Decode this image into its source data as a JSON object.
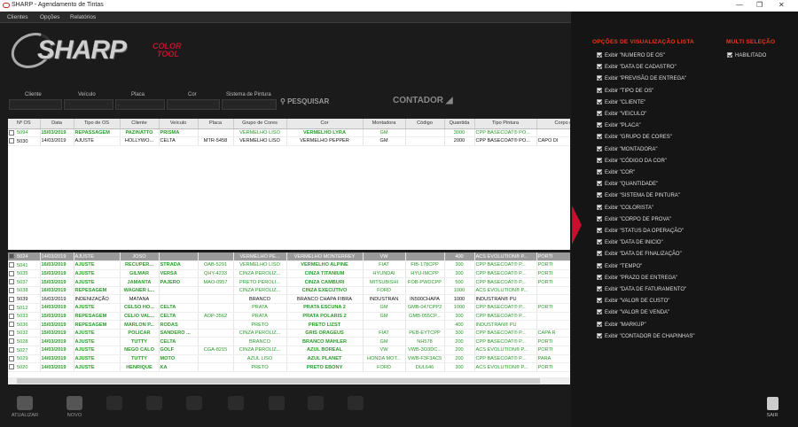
{
  "window": {
    "title": "SHARP - Agendamento de Tintas"
  },
  "menu": [
    "Clientes",
    "Opções",
    "Relatórios"
  ],
  "filters": {
    "labels": [
      "Cliente",
      "Veículo",
      "Placa",
      "Cor",
      "Sistema de Pintura"
    ]
  },
  "search_label": "PESQUISAR",
  "counter_label": "CONTADOR",
  "grid1": {
    "headers": [
      "Nº OS",
      "Data",
      "Tipo de OS",
      "Cliente",
      "Veículo",
      "Placa",
      "Grupo de Cores",
      "Cor",
      "Montadora",
      "Código",
      "Quantida",
      "Tipo Pintura",
      "Corpo de"
    ],
    "rows": [
      {
        "style": "green",
        "cells": [
          "5094",
          "15/03/2019",
          "REPASSAGEM",
          "PAZINATTO",
          "PRISMA",
          "",
          "VERMELHO LISO",
          "VERMELHO LYRA",
          "GM",
          "",
          "3000",
          "CPP BASECOAT® PO...",
          ""
        ]
      },
      {
        "style": "black",
        "cells": [
          "5030",
          "14/03/2019",
          "AJUSTE",
          "HOLLYWO...",
          "CELTA",
          "MTR-5458",
          "VERMELHO LISO",
          "VERMELHO PEPPER",
          "GM",
          "",
          "2000",
          "CPP BASECOAT® PO...",
          "CAPO DI"
        ]
      }
    ]
  },
  "grid2": {
    "rows": [
      {
        "style": "sel",
        "checked": true,
        "cells": [
          "5024",
          "14/03/2019",
          "AJUSTE",
          "JOSO",
          "",
          "",
          "VERMELHO PE...",
          "VERMELHO MONTERREY",
          "VW",
          "",
          "400",
          "ACS EVOLUTION® P...",
          "PORTI"
        ]
      },
      {
        "style": "green",
        "cells": [
          "5041",
          "16/03/2019",
          "AJUSTE",
          "RECUPER...",
          "STRADA",
          "OAB-5291",
          "VERMELHO LISO",
          "VERMELHO ALPINE",
          "FIAT",
          "FIB-178CPP",
          "300",
          "CPP BASECOAT® P...",
          "PORTI"
        ]
      },
      {
        "style": "green",
        "cells": [
          "5035",
          "15/03/2019",
          "AJUSTE",
          "GILMAR",
          "VERSA",
          "QHY-4233",
          "CINZA PEROLIZ...",
          "CINZA TITANIUM",
          "HYUNDAI",
          "HYU-IMCPP",
          "300",
          "CPP BASECOAT® P...",
          "PORTI"
        ]
      },
      {
        "style": "green",
        "cells": [
          "5037",
          "15/03/2019",
          "AJUSTE",
          "JAMANTA",
          "PAJERO",
          "MAO-0957",
          "PRETO PEROLI...",
          "CINZA CAMBURI",
          "MITSUBISHI",
          "FOB-PWDCPP",
          "500",
          "CPP BASECOAT® P...",
          "PORTI"
        ]
      },
      {
        "style": "green",
        "cells": [
          "5038",
          "16/03/2019",
          "REPESAGEM",
          "WAGNER L...",
          "",
          "",
          "CINZA PEROLIZ...",
          "CINZA EXECUTIVO",
          "FORD",
          "",
          "1000",
          "ACS EVOLUTION® P...",
          ""
        ]
      },
      {
        "style": "black",
        "cells": [
          "5039",
          "16/03/2019",
          "INDENIZAÇÃO",
          "MATANA",
          "",
          "",
          "BRANCO",
          "BRANCO CHAPA FIBRA",
          "INDUSTRAN",
          "IN500CHAPA",
          "1000",
          "INDUSTRAN® PU",
          ""
        ]
      },
      {
        "style": "green",
        "cells": [
          "5012",
          "14/03/2019",
          "AJUSTE",
          "CELSO HO...",
          "CELTA",
          "",
          "PRATA",
          "PRATA ESCUNA 2",
          "GM",
          "GMB-047CPP2",
          "1000",
          "CPP BASECOAT® P...",
          "PORTI"
        ]
      },
      {
        "style": "green",
        "cells": [
          "5033",
          "15/03/2019",
          "REPESAGEM",
          "CELIO VAL...",
          "CELTA",
          "AOP-3562",
          "PRATA",
          "PRATA POLARIS 2",
          "GM",
          "GMB-055CP...",
          "300",
          "CPP BASECOAT® P...",
          ""
        ]
      },
      {
        "style": "green",
        "cells": [
          "5036",
          "15/03/2019",
          "REPESAGEM",
          "MARLON P...",
          "RODAS",
          "",
          "PRETO",
          "PRETO LIZST",
          "",
          "",
          "400",
          "INDUSTRAN® PU",
          ""
        ]
      },
      {
        "style": "green",
        "cells": [
          "5032",
          "15/03/2019",
          "AJUSTE",
          "POLICAR",
          "SANDERO ...",
          "",
          "CINZA PEROLIZ...",
          "GRIS ORAGEUS",
          "FIAT",
          "PEB-EYTCPP",
          "300",
          "CPP BASECOAT® P...",
          "CAPA R"
        ]
      },
      {
        "style": "green",
        "cells": [
          "5028",
          "14/03/2019",
          "AJUSTE",
          "TUTTY",
          "CELTA",
          "",
          "BRANCO",
          "BRANCO MAHLER",
          "GM",
          "NH578",
          "200",
          "CPP BASECOAT® P...",
          "PORTI"
        ]
      },
      {
        "style": "green",
        "cells": [
          "5027",
          "14/03/2019",
          "AJUSTE",
          "NEGO CALO",
          "GOLF",
          "CGA-8215",
          "CINZA PEROLIZ...",
          "AZUL BOREAL",
          "VW",
          "VWB-3O3DC...",
          "200",
          "ACS EVOLUTION® P...",
          "PORTI"
        ]
      },
      {
        "style": "green",
        "cells": [
          "5029",
          "14/03/2019",
          "AJUSTE",
          "TUTTY",
          "MOTO",
          "",
          "AZUL LISO",
          "AZUL PLANET",
          "HONDA MOT...",
          "VWB-F3F3AC5",
          "200",
          "CPP BASECOAT® P...",
          "PARA"
        ]
      },
      {
        "style": "green",
        "cells": [
          "5020",
          "14/03/2019",
          "AJUSTE",
          "HENRIQUE",
          "KA",
          "",
          "PRETO",
          "PRETO EBONY",
          "FORD",
          "DUL646",
          "300",
          "ACS EVOLUTION® P...",
          "PORTI"
        ]
      }
    ]
  },
  "toolbar": {
    "atualizar": "ATUALIZAR",
    "novo": "NOVO",
    "sair": "SAIR"
  },
  "side": {
    "title": "OPÇÕES DE VISUALIZAÇÃO LISTA",
    "multi_title": "MULTI SELEÇÃO",
    "multi_opt": "HABILITADO",
    "options": [
      "Exibir \"NUMERO DE OS\"",
      "Exibir \"DATA DE CADASTRO\"",
      "Exibir \"PREVISÃO DE ENTREGA\"",
      "Exibir \"TIPO DE OS\"",
      "Exibir \"CLIENTE\"",
      "Exibir \"VEICULO\"",
      "Exibir \"PLACA\"",
      "Exibir \"GRUPO DE CORES\"",
      "Exibir \"MONTADORA\"",
      "Exibir \"CÓDIGO DA COR\"",
      "Exibir \"COR\"",
      "Exibir \"QUANTIDADE\"",
      "Exibir \"SISTEMA DE PINTURA\"",
      "Exibir \"COLORISTA\"",
      "Exibir \"CORPO DE PROVA\"",
      "Exibir \"STATUS DA OPERAÇÃO\"",
      "Exibir \"DATA DE INICIO\"",
      "Exibir \"DATA DE FINALIZAÇÃO\"",
      "Exibir \"TEMPO\"",
      "Exibir \"PRAZO DE ENTREGA\"",
      "Exibir \"DATA DE FATURAMENTO\"",
      "Exibir \"VALOR DE CUSTO\"",
      "Exibir \"VALOR DE VENDA\"",
      "Exibir \"MARKUP\"",
      "Exibir \"CONTADOR DE CHAPINHAS\""
    ]
  },
  "colors": {
    "accent": "#c8102e",
    "green": "#2a9a2a",
    "bg": "#1b1b1b"
  }
}
